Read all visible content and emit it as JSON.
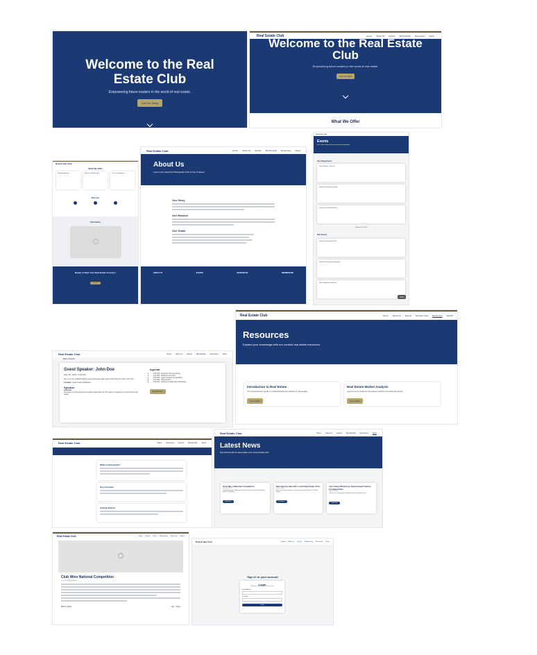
{
  "colors": {
    "navy": "#1b3a73",
    "gold": "#b5a56a",
    "text": "#1b2f5b",
    "border": "#6b5a3a"
  },
  "brand": "Real Estate Club",
  "hero": {
    "title": "Welcome to the Real Estate Club",
    "subtitle": "Empowering future leaders in the world of real estate.",
    "cta": "Join Us Today"
  },
  "hero2": {
    "title": "Welcome to the Real Estate Club",
    "subtitle": "Empowering future leaders in the world of real estate.",
    "cta": "Join Us Today",
    "section": "What We Offer",
    "nav": [
      "Home",
      "About Us",
      "Events",
      "Membership",
      "Resources",
      "News"
    ]
  },
  "landing": {
    "offer_title": "What We Offer",
    "offer_cards": [
      "Networking Events",
      "Educational Workshops",
      "Career Development"
    ],
    "steps_title": "Why Join",
    "slider_title": "Club Gallery",
    "cta_title": "Ready to Start Your Real Estate Journey?",
    "cta_btn": "Join Now"
  },
  "about": {
    "nav": [
      "Home",
      "About Us",
      "Events",
      "Membership",
      "Resources",
      "News"
    ],
    "title": "About Us",
    "subtitle": "Learn more about the Real Estate Club & Use & Values",
    "story": "Our Story",
    "mission": "Our Mission",
    "goals": "Our Goals",
    "footer_cols": [
      "ABOUT US",
      "EVENTS",
      "RESOURCES",
      "MEMBERSHIP"
    ]
  },
  "events": {
    "title": "Events",
    "subtitle": "Join us for exciting real estate events and workshops",
    "upcoming": "Upcoming Events",
    "past": "Past Events",
    "items": [
      "Guest Speaker: John Doe",
      "Real Estate Networking Night",
      "Property Valuation Workshop"
    ],
    "past_items": [
      "Commercial Real Estate 101",
      "Real Estate Investment Strategies",
      "Mock Negotiation Workshop"
    ],
    "pager": "Showing 1 to 3 of 3",
    "chat": "Chat"
  },
  "resources": {
    "nav": [
      "Home",
      "About Us",
      "Events",
      "Member Area",
      "Resources",
      "Search"
    ],
    "title": "Resources",
    "subtitle": "Expand your knowledge with our curated real estate resources.",
    "cards": [
      {
        "title": "Introduction to Real Estate",
        "desc": "A comprehensive guide to understanding the basics of real estate.",
        "btn": "Learn More"
      },
      {
        "title": "Real Estate Market Analysis",
        "desc": "Learn how to analyze real estate markets and identify trends.",
        "btn": "Learn More"
      }
    ]
  },
  "event_detail": {
    "nav": [
      "Home",
      "About Us",
      "Events",
      "Membership",
      "Resources",
      "News"
    ],
    "back": "Back to Events",
    "title": "Guest Speaker: John Doe",
    "date": "May 15, 2023 | 4:00 PM",
    "desc": "Join us for an insightful talk by commercial real estate expert with industry expert John Doe.",
    "location_label": "Location:",
    "location": "Lewis Center Auditorium",
    "speaker_title": "Speaker",
    "speaker_name": "John Doe",
    "speaker_bio": "John Doe is a commercial real estate expert with over 20 years of experience in commercial real estate.",
    "agenda_title": "Agenda",
    "agenda": [
      "4:00 PM - Check-in and networking",
      "4:15 PM - Welcome and intro",
      "4:30 PM - Guest speaker presentation",
      "5:15 PM - Q&A session",
      "5:45 PM - Closing remarks and networking"
    ],
    "btn": "Register Now"
  },
  "guide": {
    "nav": [
      "Home",
      "Resources",
      "Events",
      "Membership",
      "News"
    ],
    "sections": [
      {
        "title": "What is Real Estate?"
      },
      {
        "title": "Key Concepts"
      },
      {
        "title": "Getting Started"
      }
    ]
  },
  "news": {
    "nav": [
      "Home",
      "About Us",
      "Events",
      "Membership",
      "Resources",
      "News"
    ],
    "title": "Latest News",
    "subtitle": "Stay informed with the latest updates from the Real Estate Club",
    "cards": [
      {
        "title": "Club Wins National Competition",
        "date": "June 10, 2023",
        "desc": "Our Real Estate Club team took first place in the National Real Estate Challenge.",
        "btn": "Read More"
      },
      {
        "title": "New Partnership with Local Real Estate Firm",
        "date": "June 5, 2023",
        "desc": "We're excited to announce our new partnership with XYZ Real Estate.",
        "btn": "Read More"
      },
      {
        "title": "Upcoming Workshop: Real Estate Finance Fundamentals",
        "date": "May 28, 2023",
        "desc": "Join us for an in-depth workshop on real estate finance.",
        "btn": "Read More"
      }
    ]
  },
  "article": {
    "nav": [
      "Home",
      "Events",
      "News",
      "Membership",
      "Resources",
      "About"
    ],
    "title": "Club Wins National Competition",
    "meta": "June 10, 2023 | by Admin",
    "back": "Back to News",
    "share": "Share",
    "like": "Like"
  },
  "login": {
    "nav": [
      "Home",
      "About Us",
      "Events",
      "Membership",
      "Resources",
      "News"
    ],
    "page_title": "Sign in to your account",
    "card_title": "Login",
    "card_sub": "Enter your credentials to access your account",
    "email_label": "Email Address",
    "password_label": "Password",
    "btn": "Login"
  }
}
